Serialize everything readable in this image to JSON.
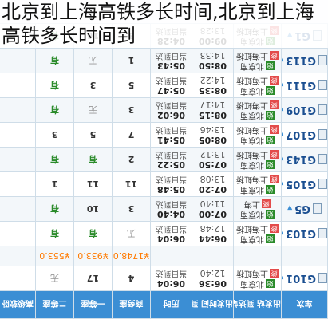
{
  "caption": "北京到上海高铁多长时间,北京到上海高铁多长时间到",
  "header": {
    "col_train": "车次",
    "col_station": "出发站 到达站",
    "col_time": "出发时间 到达时间",
    "col_duration": "历时",
    "col_business": "商务座",
    "col_first": "一等座",
    "col_second": "二等座",
    "col_extra": "高级软卧"
  },
  "price_row": {
    "business": "¥1748.0",
    "first": "¥933.0",
    "second": "¥553.0"
  },
  "rows": [
    {
      "train": "G101",
      "from": "北京南",
      "to": "上海虹桥",
      "depart": "06:36",
      "arrive": "12:40",
      "duration": "06:04",
      "duration_note": "当日到达",
      "business": "4",
      "first": "17",
      "second": "无"
    },
    {
      "train": "G103",
      "from": "北京南",
      "to": "上海虹桥",
      "depart": "06:44",
      "arrive": "12:48",
      "duration": "06:04",
      "duration_note": "当日到达",
      "business": "无",
      "first": "有",
      "second": "有"
    },
    {
      "train": "G5",
      "from": "北京南",
      "to": "上海",
      "depart": "07:00",
      "arrive": "11:40",
      "duration": "04:40",
      "duration_note": "当日到达",
      "business": "3",
      "first": "10",
      "second": "有"
    },
    {
      "train": "G105",
      "from": "北京南",
      "to": "上海虹桥",
      "depart": "07:20",
      "arrive": "13:08",
      "duration": "05:48",
      "duration_note": "当日到达",
      "business": "11",
      "first": "11",
      "second": "1"
    },
    {
      "train": "G143",
      "from": "北京南",
      "to": "上海虹桥",
      "depart": "07:50",
      "arrive": "13:12",
      "duration": "05:22",
      "duration_note": "当日到达",
      "business": "2",
      "first": "有",
      "second": "有"
    },
    {
      "train": "G107",
      "from": "北京南",
      "to": "上海虹桥",
      "depart": "08:05",
      "arrive": "13:46",
      "duration": "05:41",
      "duration_note": "当日到达",
      "business": "7",
      "first": "5",
      "second": "3"
    },
    {
      "train": "G109",
      "from": "北京南",
      "to": "上海虹桥",
      "depart": "08:15",
      "arrive": "14:17",
      "duration": "06:02",
      "duration_note": "当日到达",
      "business": "3",
      "first": "无",
      "second": "有"
    },
    {
      "train": "G111",
      "from": "北京南",
      "to": "上海虹桥",
      "depart": "08:35",
      "arrive": "14:22",
      "duration": "05:47",
      "duration_note": "当日到达",
      "business": "5",
      "first": "3",
      "second": "有"
    },
    {
      "train": "G113",
      "from": "北京南",
      "to": "上海虹桥",
      "depart": "08:50",
      "arrive": "14:33",
      "duration": "05:43",
      "duration_note": "当日到达",
      "business": "1",
      "first": "无",
      "second": "有"
    },
    {
      "train": "G1",
      "from": "北京南",
      "to": "上海虹桥",
      "depart": "09:00",
      "arrive": "13:28",
      "duration": "04:28",
      "duration_note": "当日到达",
      "business": "3",
      "first": "16",
      "second": "有"
    }
  ]
}
